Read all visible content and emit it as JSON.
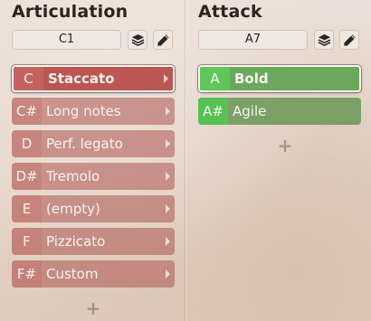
{
  "articulation": {
    "title": "Articulation",
    "trigger": "C1",
    "items": [
      {
        "note": "C",
        "label": "Staccato",
        "selected": true
      },
      {
        "note": "C#",
        "label": "Long notes",
        "selected": false
      },
      {
        "note": "D",
        "label": "Perf. legato",
        "selected": false
      },
      {
        "note": "D#",
        "label": "Tremolo",
        "selected": false
      },
      {
        "note": "E",
        "label": "(empty)",
        "selected": false
      },
      {
        "note": "F",
        "label": "Pizzicato",
        "selected": false
      },
      {
        "note": "F#",
        "label": "Custom",
        "selected": false
      }
    ],
    "add_label": "+",
    "color": "#bb5652"
  },
  "attack": {
    "title": "Attack",
    "trigger": "A7",
    "items": [
      {
        "note": "A",
        "label": "Bold",
        "selected": true
      },
      {
        "note": "A#",
        "label": "Agile",
        "selected": false
      }
    ],
    "add_label": "+",
    "color": "#69a85d"
  },
  "icons": {
    "layers": "layers-icon",
    "edit": "pencil-icon",
    "arrow": "chevron-right-icon"
  }
}
